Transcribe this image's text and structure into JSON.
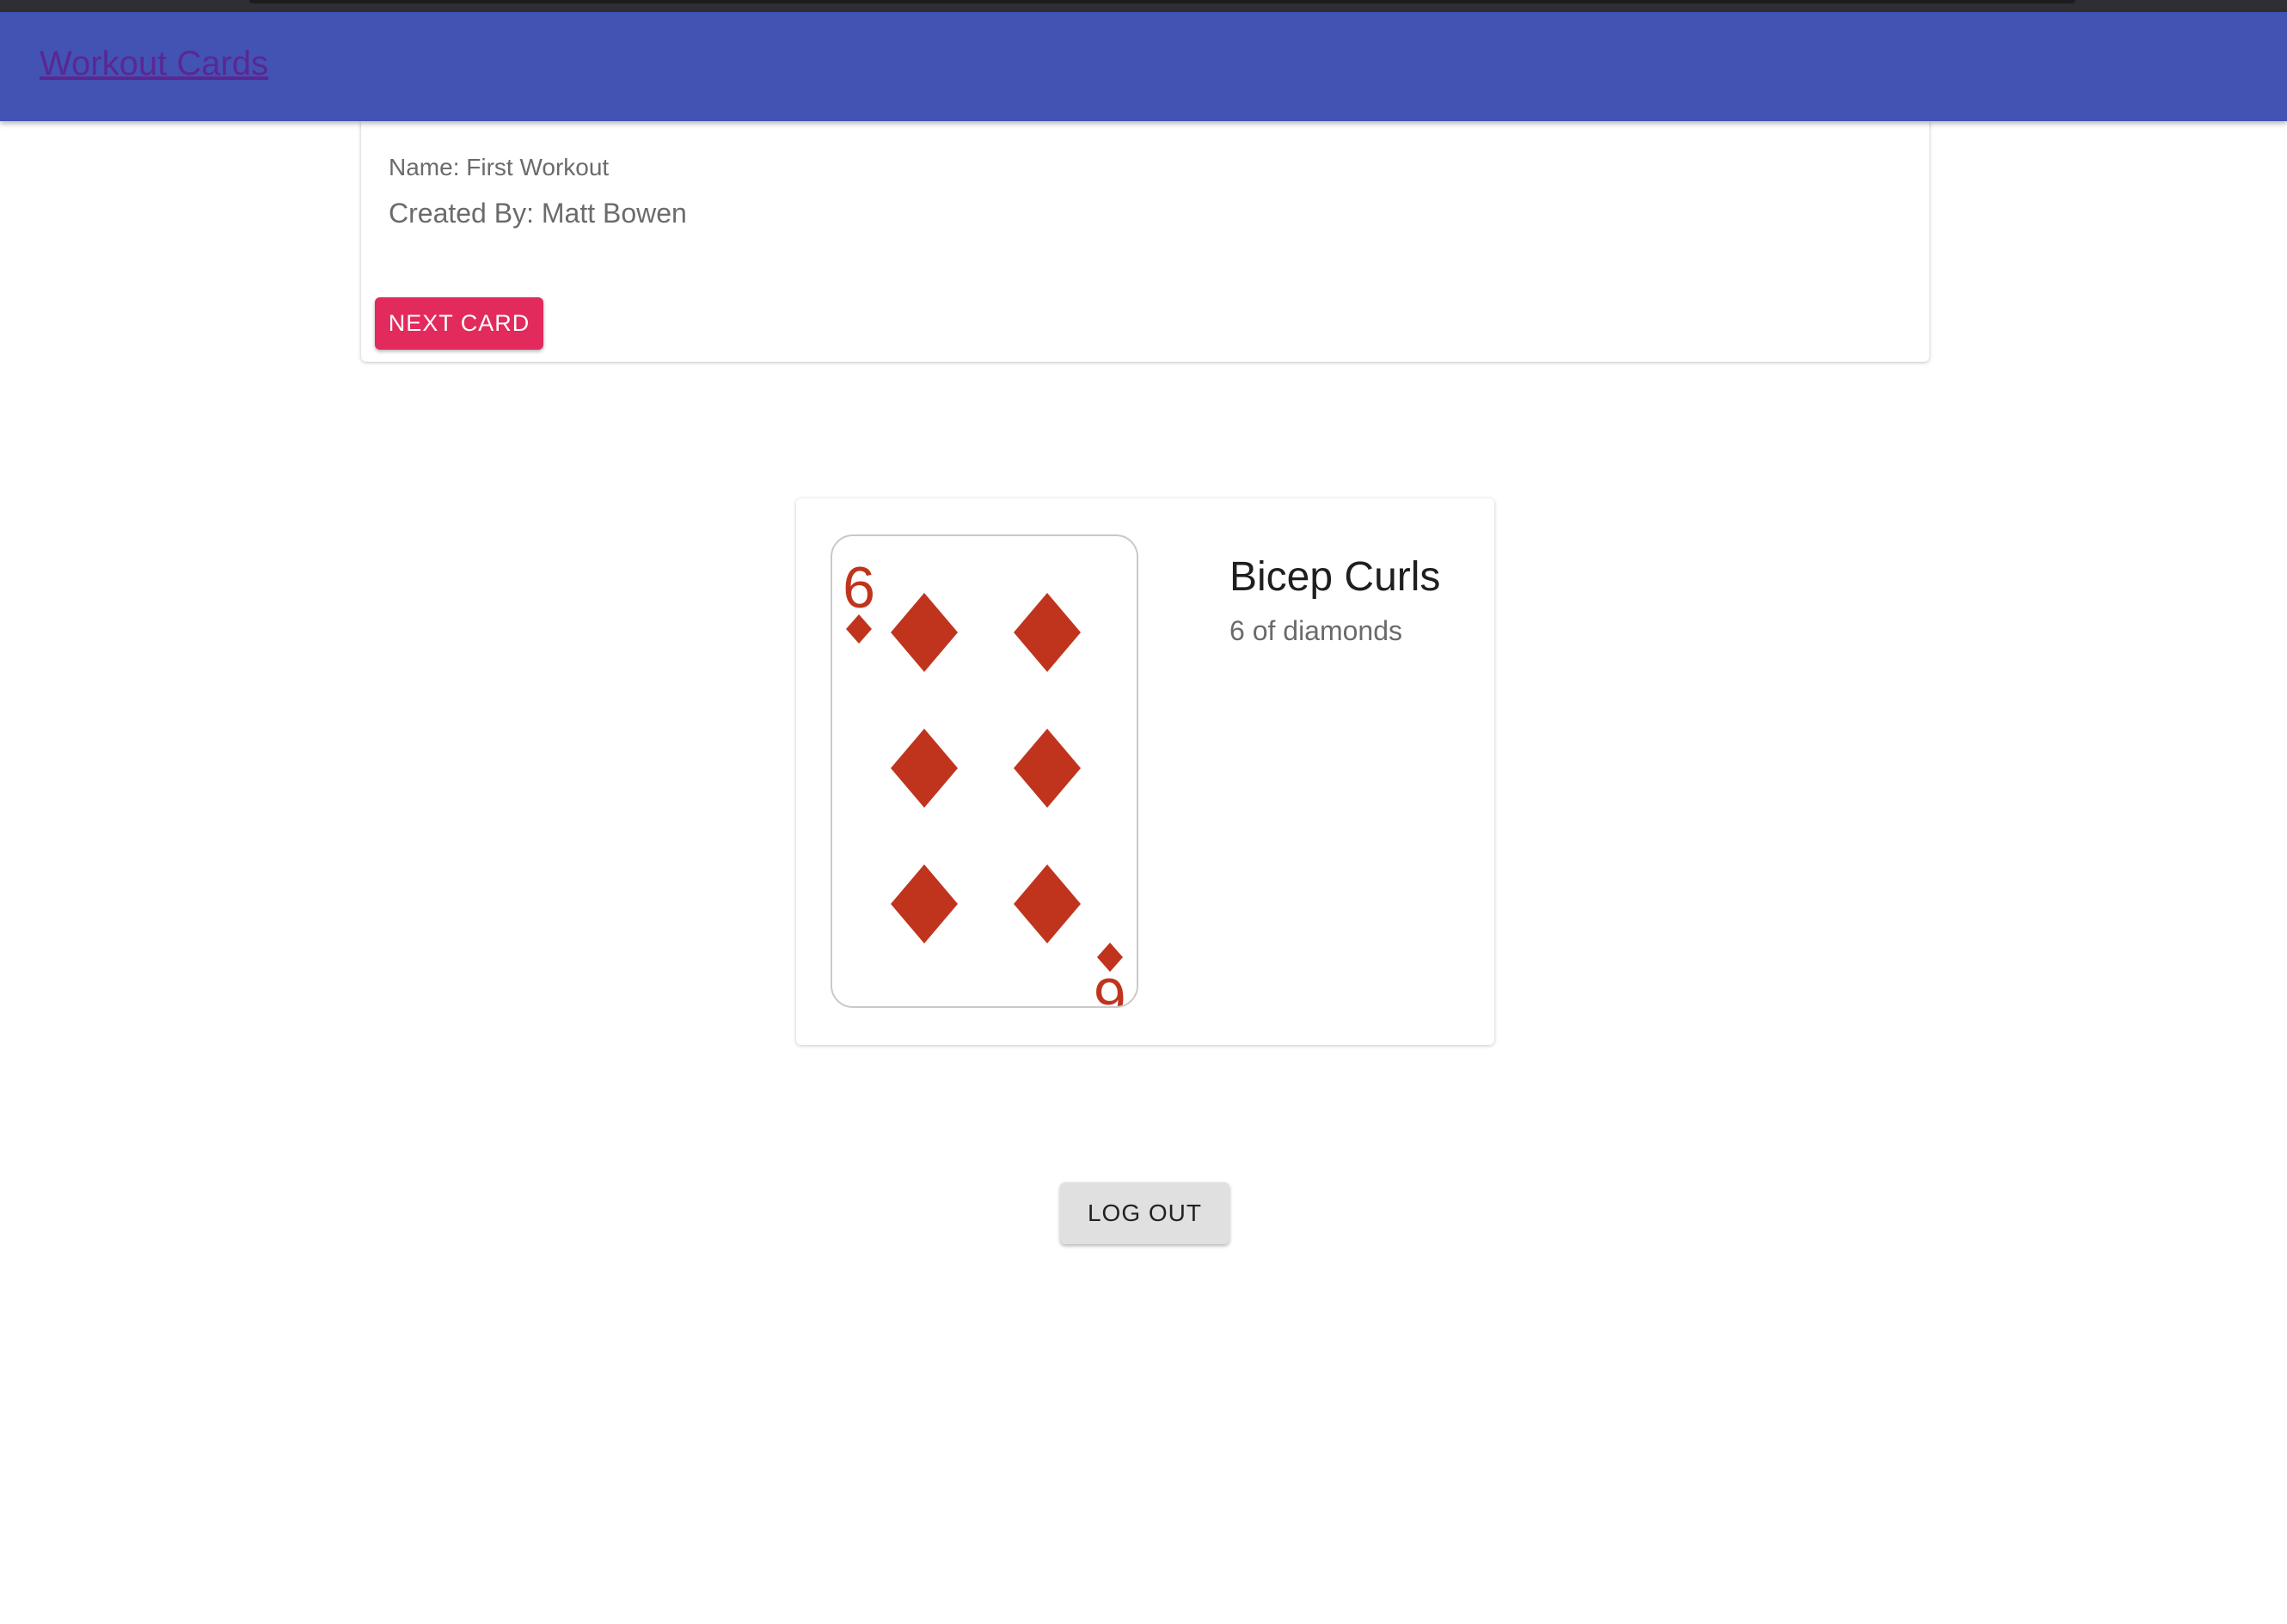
{
  "app": {
    "title": "Workout Cards"
  },
  "workout": {
    "name_text": "Name: First Workout",
    "created_by_text": "Created By: Matt Bowen",
    "next_card_label": "NEXT CARD"
  },
  "card": {
    "rank": "6",
    "suit": "diamonds",
    "suit_icon": "diamond-icon",
    "suit_color": "#c0341d",
    "exercise": "Bicep Curls",
    "description": "6 of diamonds"
  },
  "footer": {
    "logout_label": "LOG OUT"
  },
  "colors": {
    "app_bar": "#4253b4",
    "primary_button": "#e22a5c",
    "secondary_button": "#e0e0e0",
    "title_link": "#5a2793"
  }
}
